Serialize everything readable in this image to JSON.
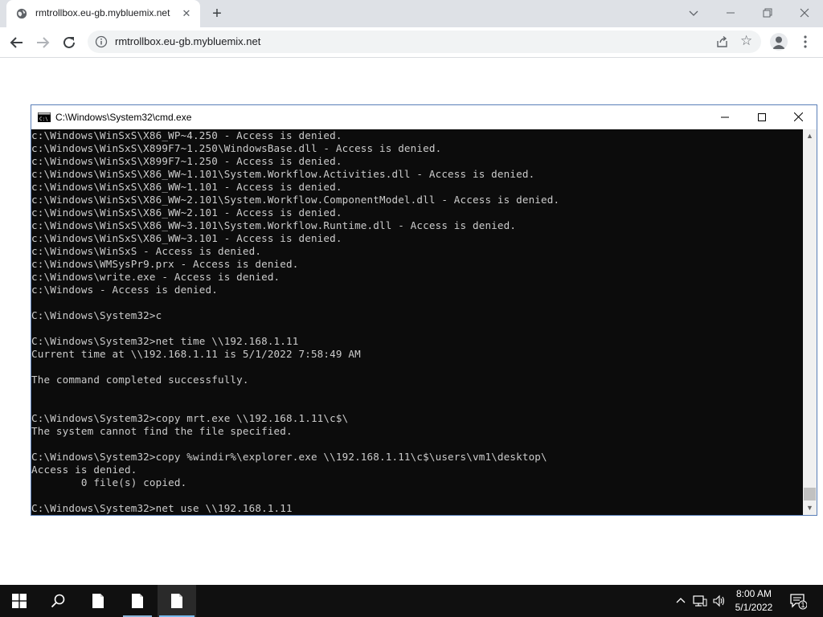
{
  "browser": {
    "tab_title": "rmtrollbox.eu-gb.mybluemix.net",
    "tab_close_glyph": "✕",
    "new_tab_glyph": "+",
    "url": "rmtrollbox.eu-gb.mybluemix.net",
    "icons": [
      "globe-icon",
      "close-icon",
      "plus-icon",
      "chevron-down-icon",
      "minimize-icon",
      "restore-icon",
      "close-icon",
      "back-arrow-icon",
      "forward-arrow-icon",
      "reload-icon",
      "info-icon",
      "share-icon",
      "star-icon",
      "profile-icon",
      "more-vert-icon"
    ]
  },
  "cmd": {
    "title": "C:\\Windows\\System32\\cmd.exe",
    "lines": [
      "c:\\Windows\\WinSxS\\X86_WP~4.250 - Access is denied.",
      "c:\\Windows\\WinSxS\\X899F7~1.250\\WindowsBase.dll - Access is denied.",
      "c:\\Windows\\WinSxS\\X899F7~1.250 - Access is denied.",
      "c:\\Windows\\WinSxS\\X86_WW~1.101\\System.Workflow.Activities.dll - Access is denied.",
      "c:\\Windows\\WinSxS\\X86_WW~1.101 - Access is denied.",
      "c:\\Windows\\WinSxS\\X86_WW~2.101\\System.Workflow.ComponentModel.dll - Access is denied.",
      "c:\\Windows\\WinSxS\\X86_WW~2.101 - Access is denied.",
      "c:\\Windows\\WinSxS\\X86_WW~3.101\\System.Workflow.Runtime.dll - Access is denied.",
      "c:\\Windows\\WinSxS\\X86_WW~3.101 - Access is denied.",
      "c:\\Windows\\WinSxS - Access is denied.",
      "c:\\Windows\\WMSysPr9.prx - Access is denied.",
      "c:\\Windows\\write.exe - Access is denied.",
      "c:\\Windows - Access is denied.",
      "",
      "C:\\Windows\\System32>c",
      "",
      "C:\\Windows\\System32>net time \\\\192.168.1.11",
      "Current time at \\\\192.168.1.11 is 5/1/2022 7:58:49 AM",
      "",
      "The command completed successfully.",
      "",
      "",
      "C:\\Windows\\System32>copy mrt.exe \\\\192.168.1.11\\c$\\",
      "The system cannot find the file specified.",
      "",
      "C:\\Windows\\System32>copy %windir%\\explorer.exe \\\\192.168.1.11\\c$\\users\\vm1\\desktop\\",
      "Access is denied.",
      "        0 file(s) copied.",
      "",
      "C:\\Windows\\System32>net use \\\\192.168.1.11"
    ]
  },
  "taskbar": {
    "clock_time": "8:00 AM",
    "clock_date": "5/1/2022",
    "notification_count": "1",
    "colors": {
      "taskbar": "#101010",
      "accent": "#76b9ed"
    }
  }
}
